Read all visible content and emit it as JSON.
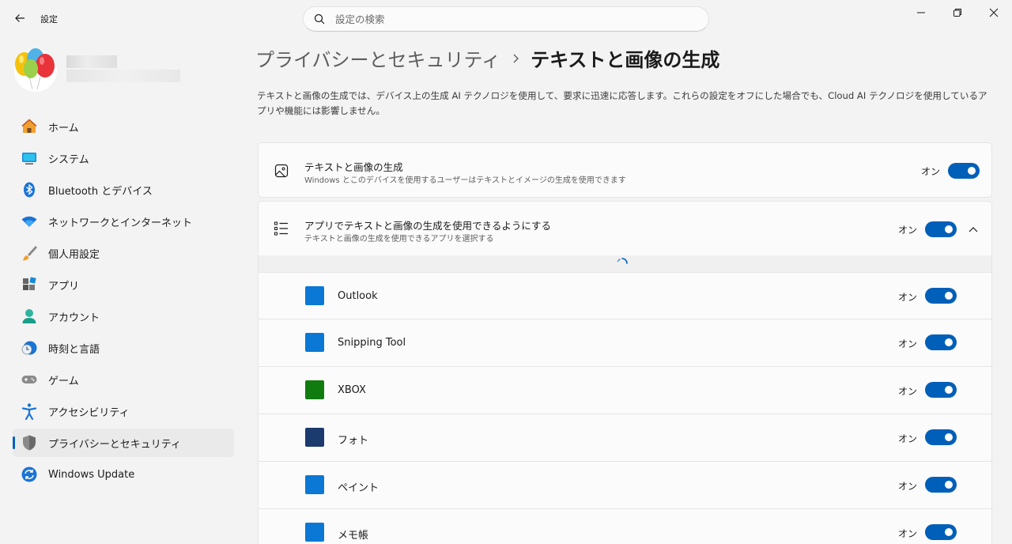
{
  "window": {
    "title": "設定",
    "search_placeholder": "設定の検索"
  },
  "sidebar": {
    "items": [
      {
        "label": "ホーム",
        "icon": "home-icon"
      },
      {
        "label": "システム",
        "icon": "system-icon"
      },
      {
        "label": "Bluetooth とデバイス",
        "icon": "bluetooth-icon"
      },
      {
        "label": "ネットワークとインターネット",
        "icon": "wifi-icon"
      },
      {
        "label": "個人用設定",
        "icon": "brush-icon"
      },
      {
        "label": "アプリ",
        "icon": "apps-icon"
      },
      {
        "label": "アカウント",
        "icon": "account-icon"
      },
      {
        "label": "時刻と言語",
        "icon": "clock-globe-icon"
      },
      {
        "label": "ゲーム",
        "icon": "gamepad-icon"
      },
      {
        "label": "アクセシビリティ",
        "icon": "accessibility-icon"
      },
      {
        "label": "プライバシーとセキュリティ",
        "icon": "shield-icon",
        "active": true
      },
      {
        "label": "Windows Update",
        "icon": "update-icon"
      }
    ]
  },
  "breadcrumb": {
    "parent": "プライバシーとセキュリティ",
    "current": "テキストと画像の生成"
  },
  "description": "テキストと画像の生成では、デバイス上の生成 AI テクノロジを使用して、要求に迅速に応答します。これらの設定をオフにした場合でも、Cloud AI テクノロジを使用しているアプリや機能には影響しません。",
  "settings": {
    "main": {
      "title": "テキストと画像の生成",
      "subtitle": "Windows とこのデバイスを使用するユーザーはテキストとイメージの生成を使用できます",
      "state": "オン"
    },
    "apps_toggle": {
      "title": "アプリでテキストと画像の生成を使用できるようにする",
      "subtitle": "テキストと画像の生成を使用できるアプリを選択する",
      "state": "オン"
    }
  },
  "apps": [
    {
      "name": "Outlook",
      "state": "オン",
      "color": "#0a78d4"
    },
    {
      "name": "Snipping Tool",
      "state": "オン",
      "color": "#0a78d4"
    },
    {
      "name": "XBOX",
      "state": "オン",
      "color": "#107c10"
    },
    {
      "name": "フォト",
      "state": "オン",
      "color": "#1b3a6e"
    },
    {
      "name": "ペイント",
      "state": "オン",
      "color": "#0a78d4"
    },
    {
      "name": "メモ帳",
      "state": "オン",
      "color": "#0a78d4"
    }
  ],
  "colors": {
    "accent": "#005fb8",
    "background": "#f3f3f3",
    "card": "#fbfbfb"
  }
}
